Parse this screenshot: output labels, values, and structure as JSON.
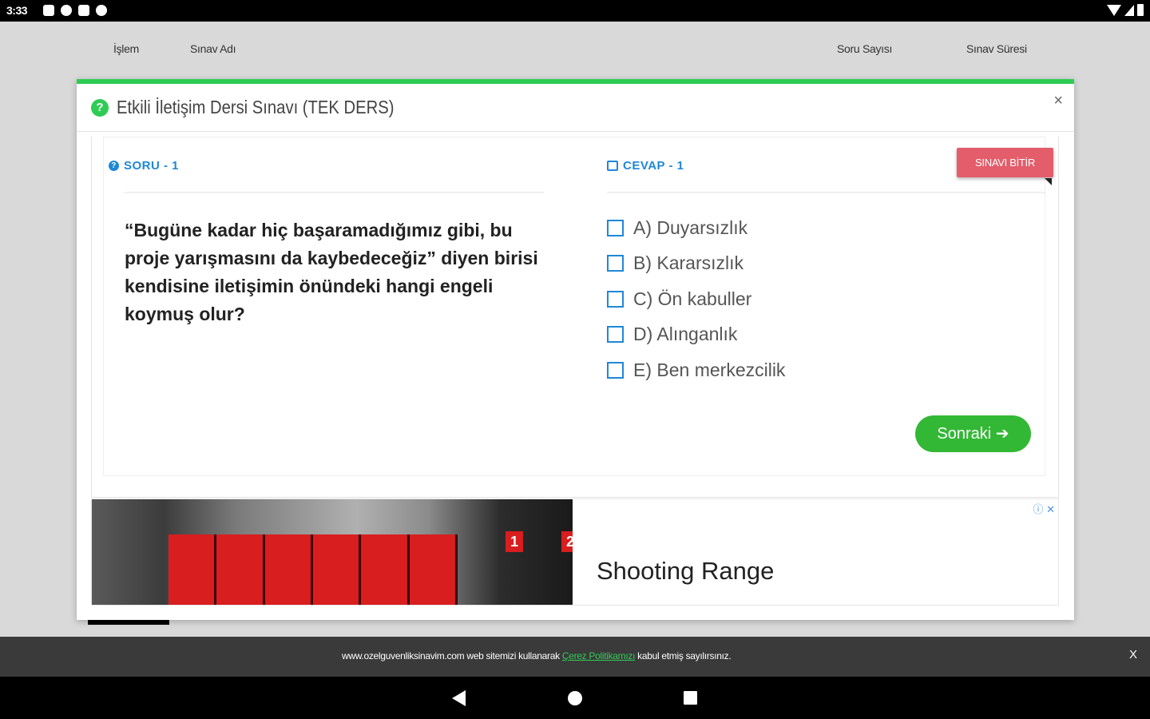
{
  "status_bar": {
    "time": "3:33"
  },
  "background_table": {
    "columns": [
      "İşlem",
      "Sınav Adı",
      "Soru Sayısı",
      "Sınav Süresi"
    ]
  },
  "modal": {
    "title": "Etkili İletişim Dersi Sınavı (TEK DERS)",
    "close_label": "×",
    "question_label": "SORU - 1",
    "answer_label": "CEVAP - 1",
    "finish_label": "SINAVI BİTİR",
    "question_text": "“Bugüne kadar hiç başaramadığımız gibi, bu proje yarışmasını da kaybedeceğiz” diyen birisi kendisine iletişimin önündeki hangi engeli koymuş olur?",
    "options": [
      "A) Duyarsızlık",
      "B) Kararsızlık",
      "C) Ön kabuller",
      "D) Alınganlık",
      "E) Ben merkezcilik"
    ],
    "next_label": "Sonraki ➔"
  },
  "ad": {
    "title": "Shooting Range",
    "badge_1": "1",
    "badge_2": "2",
    "choices_label": "ⓘ ✕"
  },
  "cookie": {
    "text_before": "www.ozelguvenliksinavim.com web sitemizi kullanarak ",
    "link": "Çerez Politikamızı",
    "text_after": " kabul etmiş sayılırsınız.",
    "close_label": "X"
  },
  "colors": {
    "accent_green": "#2ecc55",
    "link_blue": "#1e88d6",
    "finish_red": "#e35d6a",
    "next_green": "#33b836"
  }
}
